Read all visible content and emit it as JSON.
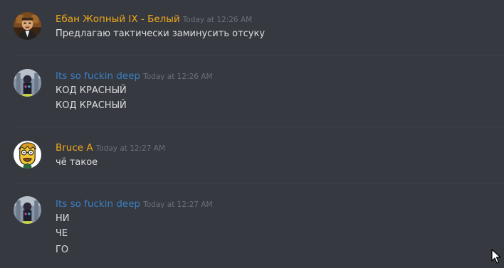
{
  "colors": {
    "background": "#36393f",
    "divider": "#40434a",
    "username_gold": "#f0a81a",
    "username_blue": "#3b7fc4",
    "text": "#dcddde",
    "timestamp": "#6c7078"
  },
  "messages": [
    {
      "username": "Ебан Жопный IX - Белый",
      "timestamp": "Today at 12:26 AM",
      "lines": [
        "Предлагаю тактически заминусить отсуку"
      ]
    },
    {
      "username": "Its so fuckin deep",
      "timestamp": "Today at 12:26 AM",
      "lines": [
        "КОД КРАСНЫЙ",
        "КОД КРАСНЫЙ"
      ]
    },
    {
      "username": "Bruce A",
      "timestamp": "Today at 12:27 AM",
      "lines": [
        "чё такое"
      ]
    },
    {
      "username": "Its so fuckin deep",
      "timestamp": "Today at 12:27 AM",
      "lines": [
        "НИ",
        "ЧЕ",
        "ГО"
      ]
    }
  ]
}
